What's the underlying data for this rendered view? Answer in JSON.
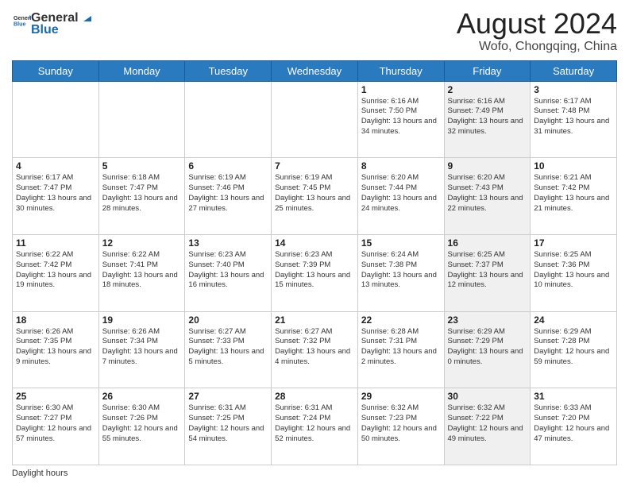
{
  "header": {
    "logo_line1": "General",
    "logo_line2": "Blue",
    "main_title": "August 2024",
    "subtitle": "Wofo, Chongqing, China"
  },
  "calendar": {
    "days_of_week": [
      "Sunday",
      "Monday",
      "Tuesday",
      "Wednesday",
      "Thursday",
      "Friday",
      "Saturday"
    ],
    "weeks": [
      [
        {
          "day": "",
          "info": "",
          "shaded": false
        },
        {
          "day": "",
          "info": "",
          "shaded": false
        },
        {
          "day": "",
          "info": "",
          "shaded": false
        },
        {
          "day": "",
          "info": "",
          "shaded": false
        },
        {
          "day": "1",
          "info": "Sunrise: 6:16 AM\nSunset: 7:50 PM\nDaylight: 13 hours and 34 minutes.",
          "shaded": false
        },
        {
          "day": "2",
          "info": "Sunrise: 6:16 AM\nSunset: 7:49 PM\nDaylight: 13 hours and 32 minutes.",
          "shaded": true
        },
        {
          "day": "3",
          "info": "Sunrise: 6:17 AM\nSunset: 7:48 PM\nDaylight: 13 hours and 31 minutes.",
          "shaded": false
        }
      ],
      [
        {
          "day": "4",
          "info": "Sunrise: 6:17 AM\nSunset: 7:47 PM\nDaylight: 13 hours and 30 minutes.",
          "shaded": false
        },
        {
          "day": "5",
          "info": "Sunrise: 6:18 AM\nSunset: 7:47 PM\nDaylight: 13 hours and 28 minutes.",
          "shaded": false
        },
        {
          "day": "6",
          "info": "Sunrise: 6:19 AM\nSunset: 7:46 PM\nDaylight: 13 hours and 27 minutes.",
          "shaded": false
        },
        {
          "day": "7",
          "info": "Sunrise: 6:19 AM\nSunset: 7:45 PM\nDaylight: 13 hours and 25 minutes.",
          "shaded": false
        },
        {
          "day": "8",
          "info": "Sunrise: 6:20 AM\nSunset: 7:44 PM\nDaylight: 13 hours and 24 minutes.",
          "shaded": false
        },
        {
          "day": "9",
          "info": "Sunrise: 6:20 AM\nSunset: 7:43 PM\nDaylight: 13 hours and 22 minutes.",
          "shaded": true
        },
        {
          "day": "10",
          "info": "Sunrise: 6:21 AM\nSunset: 7:42 PM\nDaylight: 13 hours and 21 minutes.",
          "shaded": false
        }
      ],
      [
        {
          "day": "11",
          "info": "Sunrise: 6:22 AM\nSunset: 7:42 PM\nDaylight: 13 hours and 19 minutes.",
          "shaded": false
        },
        {
          "day": "12",
          "info": "Sunrise: 6:22 AM\nSunset: 7:41 PM\nDaylight: 13 hours and 18 minutes.",
          "shaded": false
        },
        {
          "day": "13",
          "info": "Sunrise: 6:23 AM\nSunset: 7:40 PM\nDaylight: 13 hours and 16 minutes.",
          "shaded": false
        },
        {
          "day": "14",
          "info": "Sunrise: 6:23 AM\nSunset: 7:39 PM\nDaylight: 13 hours and 15 minutes.",
          "shaded": false
        },
        {
          "day": "15",
          "info": "Sunrise: 6:24 AM\nSunset: 7:38 PM\nDaylight: 13 hours and 13 minutes.",
          "shaded": false
        },
        {
          "day": "16",
          "info": "Sunrise: 6:25 AM\nSunset: 7:37 PM\nDaylight: 13 hours and 12 minutes.",
          "shaded": true
        },
        {
          "day": "17",
          "info": "Sunrise: 6:25 AM\nSunset: 7:36 PM\nDaylight: 13 hours and 10 minutes.",
          "shaded": false
        }
      ],
      [
        {
          "day": "18",
          "info": "Sunrise: 6:26 AM\nSunset: 7:35 PM\nDaylight: 13 hours and 9 minutes.",
          "shaded": false
        },
        {
          "day": "19",
          "info": "Sunrise: 6:26 AM\nSunset: 7:34 PM\nDaylight: 13 hours and 7 minutes.",
          "shaded": false
        },
        {
          "day": "20",
          "info": "Sunrise: 6:27 AM\nSunset: 7:33 PM\nDaylight: 13 hours and 5 minutes.",
          "shaded": false
        },
        {
          "day": "21",
          "info": "Sunrise: 6:27 AM\nSunset: 7:32 PM\nDaylight: 13 hours and 4 minutes.",
          "shaded": false
        },
        {
          "day": "22",
          "info": "Sunrise: 6:28 AM\nSunset: 7:31 PM\nDaylight: 13 hours and 2 minutes.",
          "shaded": false
        },
        {
          "day": "23",
          "info": "Sunrise: 6:29 AM\nSunset: 7:29 PM\nDaylight: 13 hours and 0 minutes.",
          "shaded": true
        },
        {
          "day": "24",
          "info": "Sunrise: 6:29 AM\nSunset: 7:28 PM\nDaylight: 12 hours and 59 minutes.",
          "shaded": false
        }
      ],
      [
        {
          "day": "25",
          "info": "Sunrise: 6:30 AM\nSunset: 7:27 PM\nDaylight: 12 hours and 57 minutes.",
          "shaded": false
        },
        {
          "day": "26",
          "info": "Sunrise: 6:30 AM\nSunset: 7:26 PM\nDaylight: 12 hours and 55 minutes.",
          "shaded": false
        },
        {
          "day": "27",
          "info": "Sunrise: 6:31 AM\nSunset: 7:25 PM\nDaylight: 12 hours and 54 minutes.",
          "shaded": false
        },
        {
          "day": "28",
          "info": "Sunrise: 6:31 AM\nSunset: 7:24 PM\nDaylight: 12 hours and 52 minutes.",
          "shaded": false
        },
        {
          "day": "29",
          "info": "Sunrise: 6:32 AM\nSunset: 7:23 PM\nDaylight: 12 hours and 50 minutes.",
          "shaded": false
        },
        {
          "day": "30",
          "info": "Sunrise: 6:32 AM\nSunset: 7:22 PM\nDaylight: 12 hours and 49 minutes.",
          "shaded": true
        },
        {
          "day": "31",
          "info": "Sunrise: 6:33 AM\nSunset: 7:20 PM\nDaylight: 12 hours and 47 minutes.",
          "shaded": false
        }
      ]
    ]
  },
  "footer": {
    "text": "Daylight hours"
  }
}
